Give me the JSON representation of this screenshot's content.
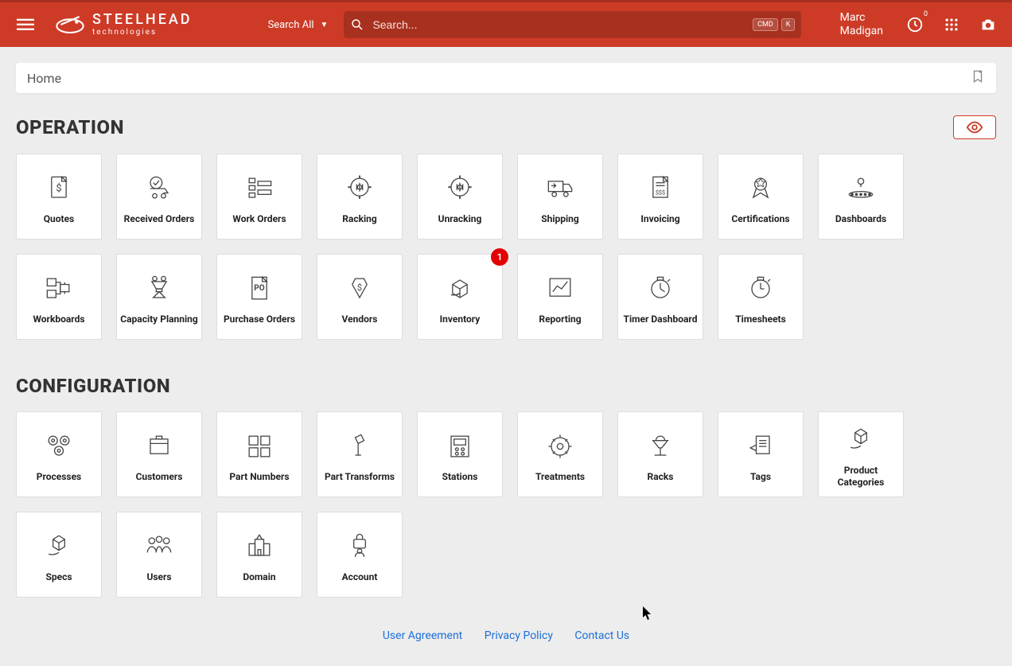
{
  "brand": {
    "name": "STEELHEAD",
    "sub": "technologies"
  },
  "searchScope": "Search All",
  "search": {
    "placeholder": "Search...",
    "kbd1": "CMD",
    "kbd2": "K"
  },
  "user": {
    "first": "Marc",
    "last": "Madigan"
  },
  "clockBadge": "0",
  "breadcrumb": "Home",
  "sections": {
    "operation": {
      "title": "OPERATION",
      "tiles": [
        {
          "label": "Quotes",
          "icon": "quote",
          "badge": null
        },
        {
          "label": "Received Orders",
          "icon": "received",
          "badge": null
        },
        {
          "label": "Work Orders",
          "icon": "workorders",
          "badge": null
        },
        {
          "label": "Racking",
          "icon": "racking",
          "badge": null
        },
        {
          "label": "Unracking",
          "icon": "unracking",
          "badge": null
        },
        {
          "label": "Shipping",
          "icon": "shipping",
          "badge": null
        },
        {
          "label": "Invoicing",
          "icon": "invoicing",
          "badge": null
        },
        {
          "label": "Certifications",
          "icon": "cert",
          "badge": null
        },
        {
          "label": "Dashboards",
          "icon": "dashboards",
          "badge": null
        },
        {
          "label": "Workboards",
          "icon": "workboards",
          "badge": null
        },
        {
          "label": "Capacity Planning",
          "icon": "capacity",
          "badge": null
        },
        {
          "label": "Purchase Orders",
          "icon": "po",
          "badge": null
        },
        {
          "label": "Vendors",
          "icon": "vendors",
          "badge": null
        },
        {
          "label": "Inventory",
          "icon": "inventory",
          "badge": "1"
        },
        {
          "label": "Reporting",
          "icon": "reporting",
          "badge": null
        },
        {
          "label": "Timer Dashboard",
          "icon": "timerdash",
          "badge": null
        },
        {
          "label": "Timesheets",
          "icon": "timesheets",
          "badge": null
        }
      ]
    },
    "configuration": {
      "title": "CONFIGURATION",
      "tiles": [
        {
          "label": "Processes",
          "icon": "processes",
          "badge": null
        },
        {
          "label": "Customers",
          "icon": "customers",
          "badge": null
        },
        {
          "label": "Part Numbers",
          "icon": "parts",
          "badge": null
        },
        {
          "label": "Part Transforms",
          "icon": "transforms",
          "badge": null
        },
        {
          "label": "Stations",
          "icon": "stations",
          "badge": null
        },
        {
          "label": "Treatments",
          "icon": "treatments",
          "badge": null
        },
        {
          "label": "Racks",
          "icon": "racks",
          "badge": null
        },
        {
          "label": "Tags",
          "icon": "tags",
          "badge": null
        },
        {
          "label": "Product Categories",
          "icon": "categories",
          "badge": null
        },
        {
          "label": "Specs",
          "icon": "specs",
          "badge": null
        },
        {
          "label": "Users",
          "icon": "users",
          "badge": null
        },
        {
          "label": "Domain",
          "icon": "domain",
          "badge": null
        },
        {
          "label": "Account",
          "icon": "account",
          "badge": null
        }
      ]
    }
  },
  "footer": {
    "agreement": "User Agreement",
    "privacy": "Privacy Policy",
    "contact": "Contact Us"
  }
}
